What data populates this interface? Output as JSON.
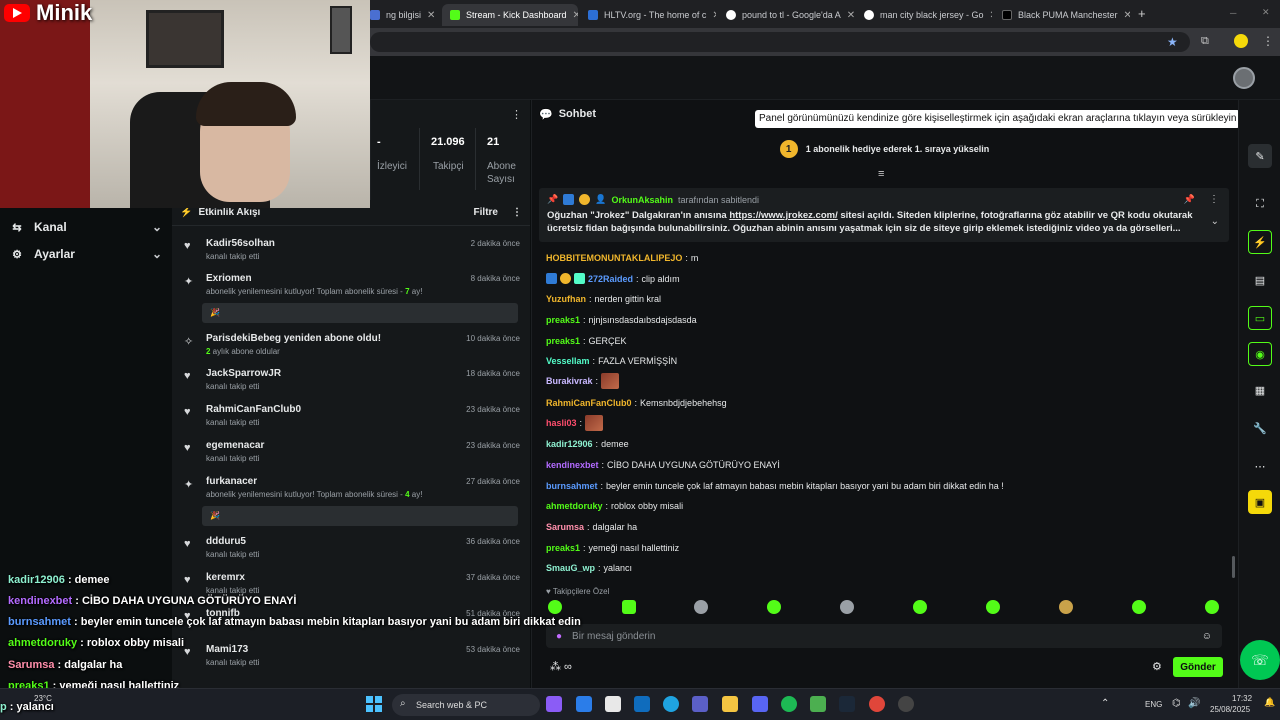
{
  "browser": {
    "tabs": [
      {
        "title": "ng bilgisi",
        "active": false,
        "color": "#4a6fd1"
      },
      {
        "title": "Stream - Kick Dashboard",
        "active": true,
        "color": "#53fc18"
      },
      {
        "title": "HLTV.org - The home of c",
        "active": false,
        "color": "#2c6fd6"
      },
      {
        "title": "pound to tl - Google'da A",
        "active": false,
        "color": "#ffffff"
      },
      {
        "title": "man city black jersey - Go",
        "active": false,
        "color": "#ffffff"
      },
      {
        "title": "Black PUMA Manchester",
        "active": false,
        "color": "#000000"
      }
    ]
  },
  "webcam_overlay": {
    "channel_name": "Minik"
  },
  "leftnav": {
    "items": [
      {
        "label": "Kanal"
      },
      {
        "label": "Ayarlar"
      }
    ]
  },
  "stats": [
    {
      "value": "-",
      "label": "İzleyici"
    },
    {
      "value": "21.096",
      "label": "Takipçi"
    },
    {
      "value": "21",
      "label": "Abone Sayısı"
    }
  ],
  "feed": {
    "title": "Etkinlik Akışı",
    "filter_label": "Filtre",
    "items": [
      {
        "name": "Kadir56solhan",
        "sub": "kanalı takip etti",
        "time": "2 dakika önce",
        "icon": "heart"
      },
      {
        "name": "Exriomen",
        "sub": "abonelik yenilemesini kutluyor! Toplam abonelik süresi - ",
        "months": "7",
        "sub_end": " ay!",
        "time": "8 dakika önce",
        "icon": "star",
        "box": "🎉"
      },
      {
        "name": "ParisdekiBebeg yeniden abone oldu!",
        "sub_prefix": "2",
        "sub": " aylık abone oldular",
        "time": "10 dakika önce",
        "icon": "sparkle"
      },
      {
        "name": "JackSparrowJR",
        "sub": "kanalı takip etti",
        "time": "18 dakika önce",
        "icon": "heart"
      },
      {
        "name": "RahmiCanFanClub0",
        "sub": "kanalı takip etti",
        "time": "23 dakika önce",
        "icon": "heart"
      },
      {
        "name": "egemenacar",
        "sub": "kanalı takip etti",
        "time": "23 dakika önce",
        "icon": "heart"
      },
      {
        "name": "furkanacer",
        "sub": "abonelik yenilemesini kutluyor! Toplam abonelik süresi - ",
        "months": "4",
        "sub_end": " ay!",
        "time": "27 dakika önce",
        "icon": "star",
        "box": "🎉"
      },
      {
        "name": "ddduru5",
        "sub": "kanalı takip etti",
        "time": "36 dakika önce",
        "icon": "heart"
      },
      {
        "name": "keremrx",
        "sub": "kanalı takip etti",
        "time": "37 dakika önce",
        "icon": "heart"
      },
      {
        "name": "tonnifb",
        "sub": "",
        "time": "51 dakika önce",
        "icon": "heart"
      },
      {
        "name": "Mami173",
        "sub": "kanalı takip etti",
        "time": "53 dakika önce",
        "icon": "heart"
      }
    ]
  },
  "chat": {
    "title": "Sohbet",
    "tooltip": "Panel görünümünüzü kendinize göre kişiselleştirmek için aşağıdaki ekran araçlarına tıklayın veya sürükleyin",
    "gift_rank": "1",
    "gift_text": "1 abonelik hediye ederek 1. sıraya yükselin",
    "pinned": {
      "user": "OrkunAksahin",
      "suffix": "tarafından sabitlendi",
      "text_a": "Oğuzhan \"Jrokez\" Dalgakıran'ın anısına ",
      "link": "https://www.jrokez.com/",
      "text_b": " sitesi açıldı. Siteden kliplerine, fotoğraflarına göz atabilir ve QR kodu okutarak ücretsiz fidan bağışında bulunabilirsiniz. Oğuzhan abinin anısını yaşatmak için siz de siteye girip eklemek istediğiniz video ya da görselleri..."
    },
    "messages": [
      {
        "user": "HOBBITEMONUNTAKLALIPEJO",
        "text": "m",
        "color": "#f0b62c"
      },
      {
        "user": "272Raided",
        "text": "clip aldım",
        "color": "#5b9bff"
      },
      {
        "user": "Yuzufhan",
        "text": "nerden gittin kral",
        "color": "#f0b62c"
      },
      {
        "user": "preaks1",
        "text": "njnjsınsdasdaıbsdajsdasda",
        "color": "#53fc18"
      },
      {
        "user": "preaks1",
        "text": "GERÇEK",
        "color": "#53fc18"
      },
      {
        "user": "Vessellam",
        "text": "FAZLA VERMİŞŞİN",
        "color": "#53fcc8"
      },
      {
        "user": "Burakivrak",
        "text": "",
        "color": "#c9b8ff",
        "emote": true
      },
      {
        "user": "RahmiCanFanClub0",
        "text": "Kemsnbdjdjebehehsg",
        "color": "#f0b62c"
      },
      {
        "user": "hasli03",
        "text": "",
        "color": "#ff4d6d",
        "emote": true
      },
      {
        "user": "kadir12906",
        "text": "demee",
        "color": "#8ef0d0"
      },
      {
        "user": "kendinexbet",
        "text": "CİBO DAHA UYGUNA GÖTÜRÜYO ENAYİ",
        "color": "#b36bff"
      },
      {
        "user": "burnsahmet",
        "text": "beyler emin tuncele çok laf atmayın babası mebin kitapları basıyor yani bu adam biri dikkat edin ha !",
        "color": "#5b9bff"
      },
      {
        "user": "ahmetdoruky",
        "text": "roblox obby misali",
        "color": "#53fc18"
      },
      {
        "user": "Sarumsa",
        "text": "dalgalar ha",
        "color": "#ff8fab"
      },
      {
        "user": "preaks1",
        "text": "yemeği nasıl hallettiniz",
        "color": "#53fc18"
      },
      {
        "user": "SmauG_wp",
        "text": "yalancı",
        "color": "#8ef0d0"
      }
    ],
    "followers_label": "Takipçilere Özel",
    "input_placeholder": "Bir mesaj gönderin",
    "send_label": "Gönder"
  },
  "overlay_chat": [
    {
      "user": "kadir12906",
      "text": " : demee",
      "color": "#8ef0d0"
    },
    {
      "user": "kendinexbet",
      "text": " : CİBO DAHA UYGUNA GÖTÜRÜYO ENAYİ",
      "color": "#b36bff"
    },
    {
      "user": "burnsahmet",
      "text": " : beyler emin tuncele çok laf atmayın babası mebin kitapları basıyor yani bu adam biri dikkat edin",
      "color": "#5b9bff"
    },
    {
      "user": "ahmetdoruky",
      "text": " : roblox obby misali",
      "color": "#53fc18"
    },
    {
      "user": "Sarumsa",
      "text": " : dalgalar ha",
      "color": "#ff8fab"
    },
    {
      "user": "preaks1",
      "text": " : yemeği nasıl hallettiniz",
      "color": "#53fc18"
    },
    {
      "user": "p",
      "text": " : yalancı",
      "color": "#8ef0d0"
    }
  ],
  "taskbar": {
    "search_label": "Search web & PC",
    "weather": "23°C",
    "lang": "ENG",
    "time": "17:32",
    "date": "25/08/2025"
  }
}
